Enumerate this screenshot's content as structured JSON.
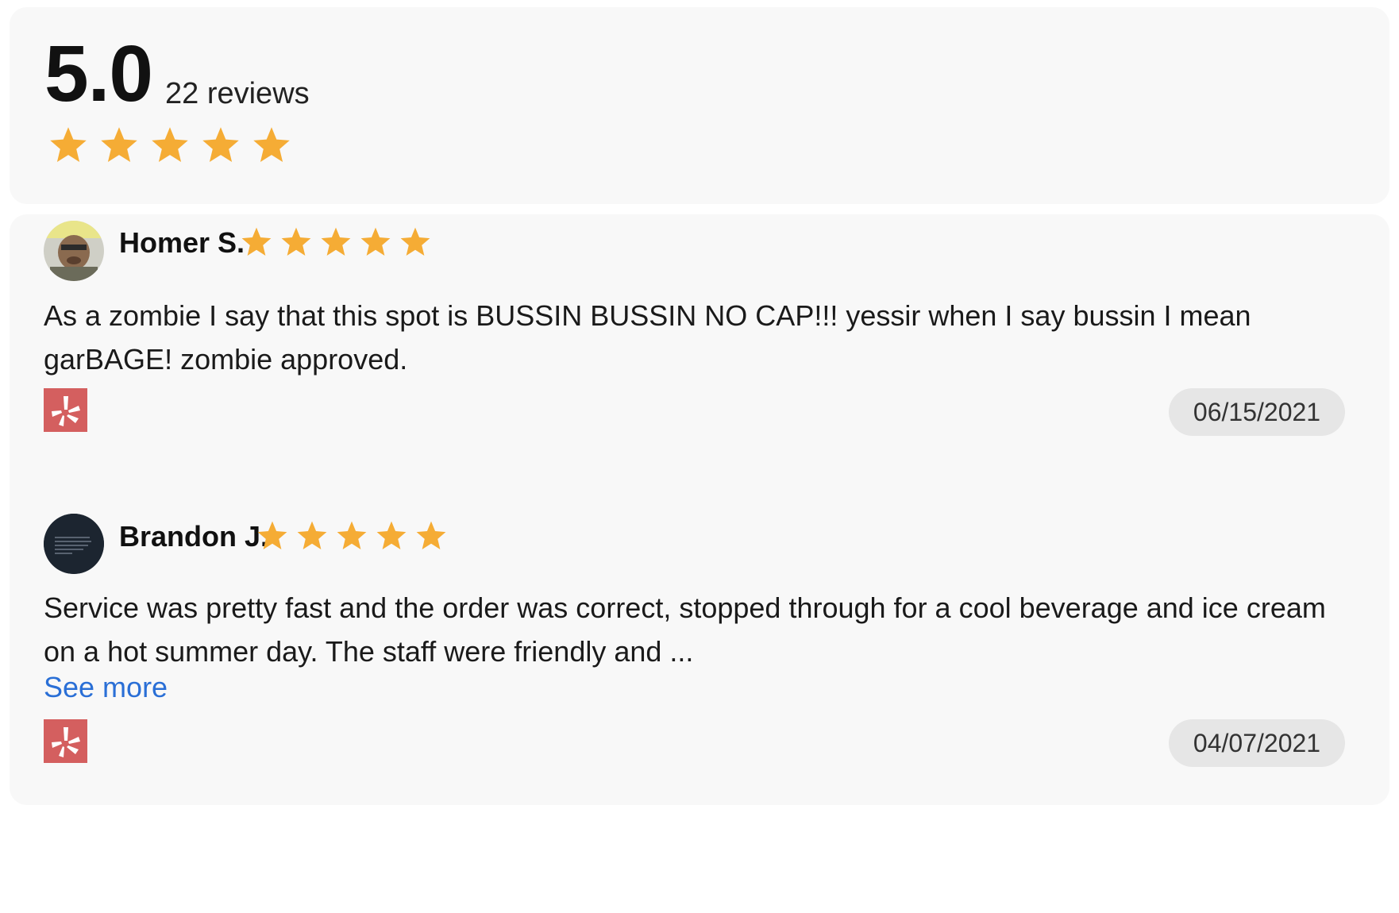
{
  "summary": {
    "score": "5.0",
    "review_count": "22 reviews",
    "rating": 5,
    "max_rating": 5
  },
  "colors": {
    "star": "#f5ac35",
    "card_background": "#f8f8f8",
    "date_badge_background": "#e6e6e6",
    "link": "#2a6fd6",
    "yelp_logo": "#d45f5f"
  },
  "reviews": [
    {
      "name": "Homer S.",
      "rating": 5,
      "text": "As a zombie I say that this spot is BUSSIN BUSSIN NO CAP!!! yessir when I say bussin I mean garBAGE! zombie approved.",
      "source_icon": "yelp-icon",
      "date": "06/15/2021"
    },
    {
      "name": "Brandon J.",
      "rating": 5,
      "text": "Service was pretty fast and the order was correct, stopped through for a cool beverage and ice cream on a hot summer day. The staff were friendly and ...",
      "see_more": "See more",
      "source_icon": "yelp-icon",
      "date": "04/07/2021"
    }
  ]
}
